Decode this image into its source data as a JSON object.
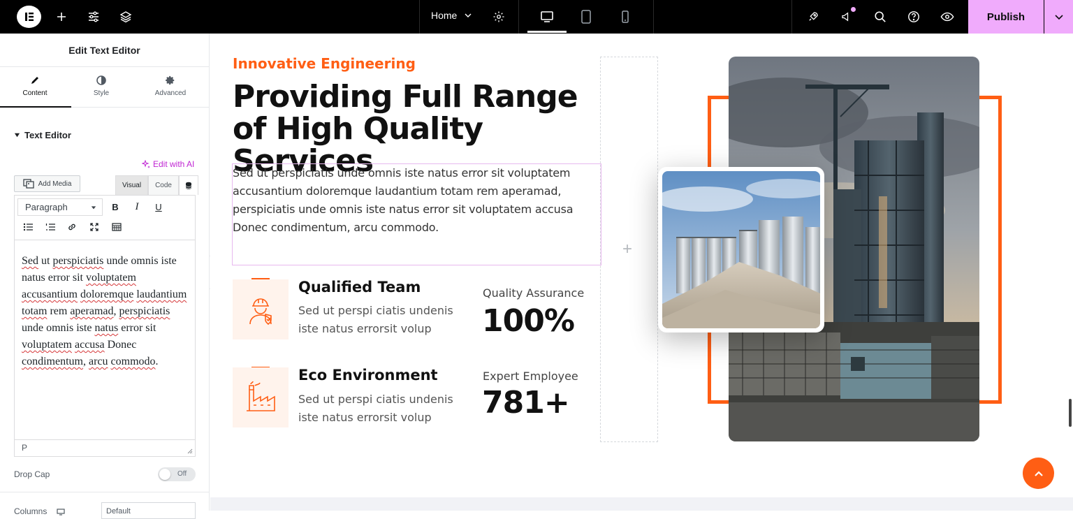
{
  "topbar": {
    "page_name": "Home",
    "publish_label": "Publish"
  },
  "panel": {
    "title": "Edit Text Editor",
    "tabs": [
      {
        "label": "Content",
        "icon": "pencil-icon"
      },
      {
        "label": "Style",
        "icon": "half-circle-icon"
      },
      {
        "label": "Advanced",
        "icon": "gear-icon"
      }
    ],
    "section_title": "Text Editor",
    "edit_ai_label": "Edit with AI",
    "add_media_label": "Add Media",
    "mode_tabs": [
      "Visual",
      "Code"
    ],
    "format_select": "Paragraph",
    "editor_text": [
      "Sed",
      " ut ",
      "perspiciatis",
      " unde omnis iste natus error sit ",
      "voluptatem",
      " ",
      "accusantium",
      " ",
      "doloremque",
      " ",
      "laudantium",
      " ",
      "totam",
      " rem ",
      "aperamad",
      ", ",
      "perspiciatis",
      " unde omnis iste ",
      "natus",
      " error sit ",
      "voluptatem",
      " ",
      "accusa",
      " Donec ",
      "condimentum",
      ", ",
      "arcu",
      " ",
      "commodo",
      "."
    ],
    "status_path": "P",
    "drop_cap_label": "Drop Cap",
    "drop_cap_state": "Off",
    "columns_label": "Columns",
    "columns_value": "Default"
  },
  "canvas": {
    "eyebrow": "Innovative Engineering",
    "headline": "Providing Full Range of High Quality Services",
    "lead": "Sed ut perspiciatis unde omnis iste natus error sit voluptatem accusantium doloremque laudantium totam rem aperamad, perspiciatis unde omnis iste natus error sit voluptatem accusa Donec condimentum, arcu commodo.",
    "features": [
      {
        "title": "Qualified Team",
        "desc": "Sed ut perspi ciatis undenis iste natus errorsit volup",
        "icon": "engineer-icon"
      },
      {
        "title": "Eco Environment",
        "desc": "Sed ut perspi ciatis undenis iste natus errorsit volup",
        "icon": "factory-icon"
      }
    ],
    "stats": [
      {
        "label": "Quality Assurance",
        "value": "100%"
      },
      {
        "label": "Expert Employee",
        "value": "781+"
      }
    ]
  },
  "colors": {
    "accent": "#ff5e14",
    "publish": "#f0abfc",
    "ai": "#c026d3"
  }
}
